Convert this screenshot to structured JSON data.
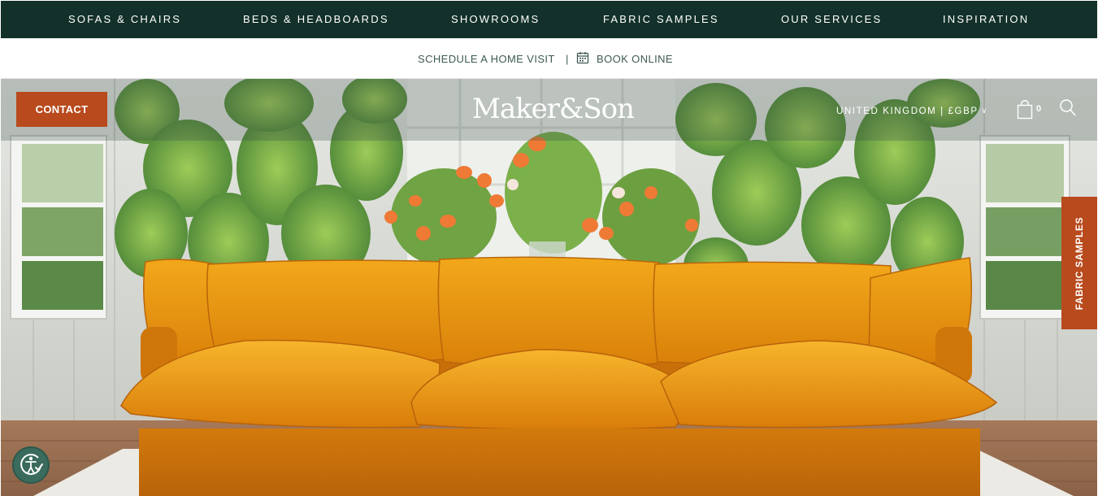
{
  "nav": {
    "items": [
      {
        "label": "SOFAS & CHAIRS"
      },
      {
        "label": "BEDS & HEADBOARDS"
      },
      {
        "label": "SHOWROOMS"
      },
      {
        "label": "FABRIC SAMPLES"
      },
      {
        "label": "OUR SERVICES"
      },
      {
        "label": "INSPIRATION"
      }
    ]
  },
  "subbar": {
    "home_visit": "SCHEDULE A HOME VISIT",
    "separator": "|",
    "book_online": "BOOK ONLINE",
    "book_icon": "calendar-icon"
  },
  "header": {
    "contact_label": "CONTACT",
    "logo_text": "Maker&Son",
    "region_label": "UNITED KINGDOM | £GBP",
    "cart_count": "0",
    "cart_icon": "shopping-bag-icon",
    "search_icon": "search-icon"
  },
  "side_tab": {
    "label": "FABRIC SAMPLES"
  },
  "accessibility": {
    "icon": "accessibility-icon"
  },
  "colors": {
    "nav_bg": "#13302a",
    "accent": "#b84a1d",
    "subbar_text": "#3e5a54",
    "sofa": "#e99412"
  }
}
